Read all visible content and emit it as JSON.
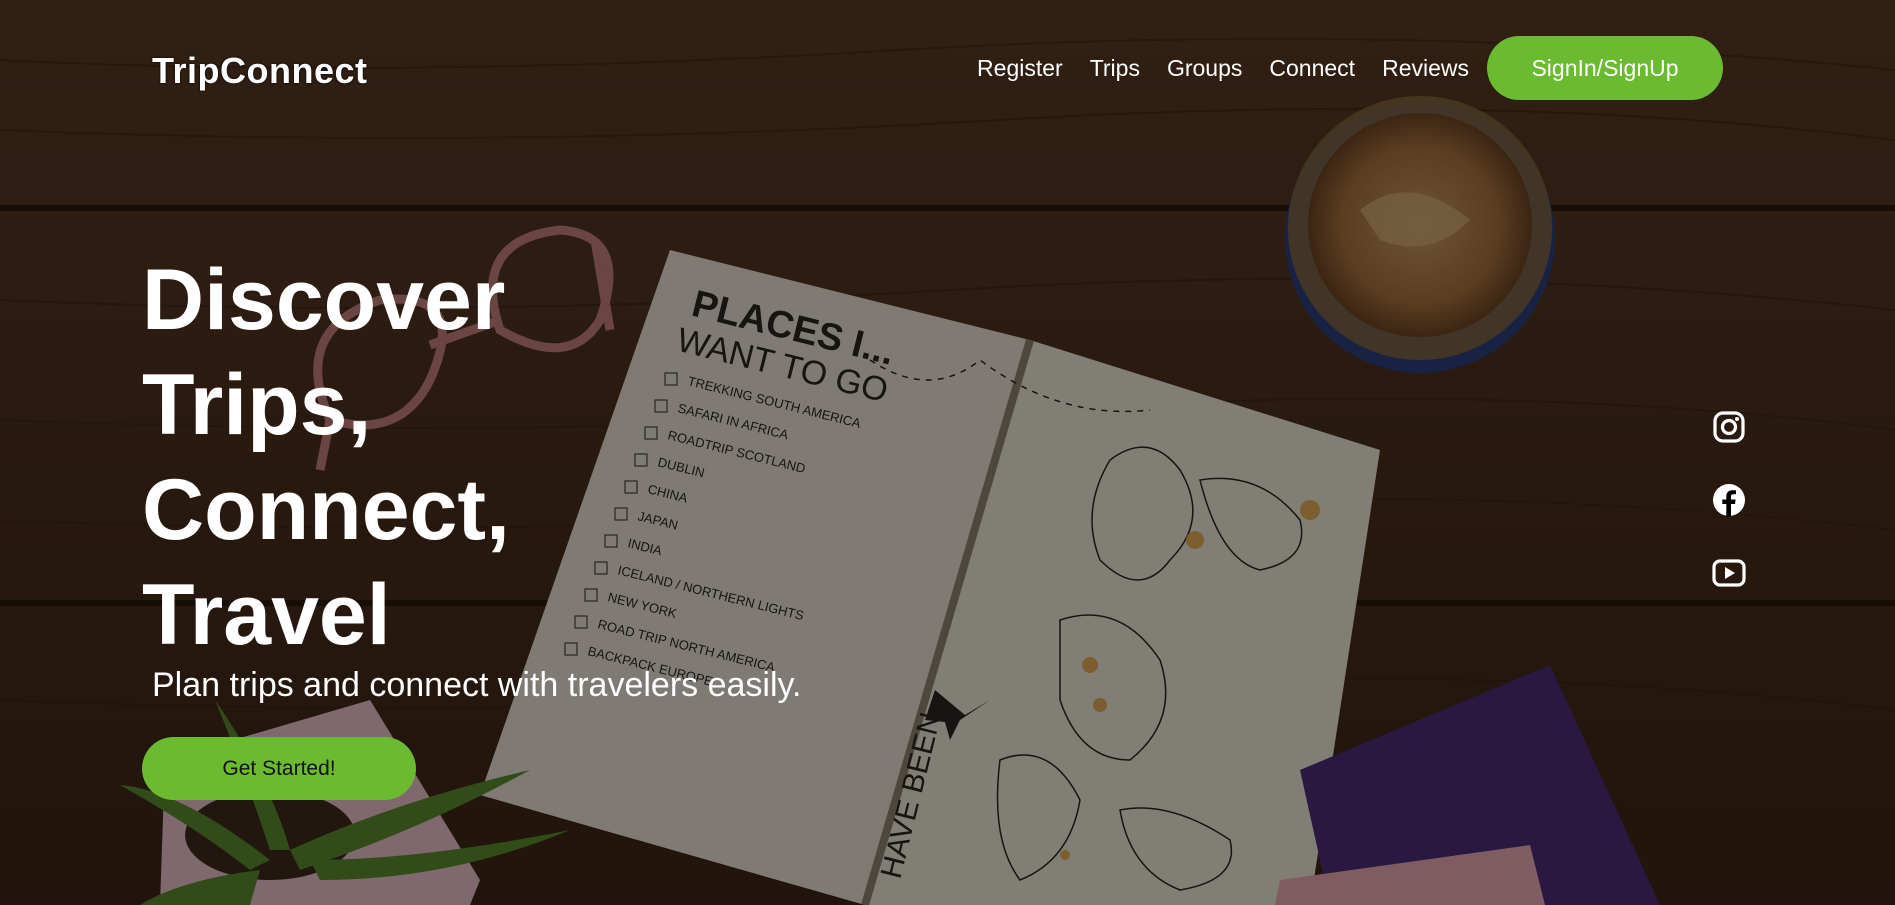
{
  "brand": {
    "name": "TripConnect"
  },
  "nav": {
    "items": [
      {
        "label": "Register"
      },
      {
        "label": "Trips"
      },
      {
        "label": "Groups"
      },
      {
        "label": "Connect"
      },
      {
        "label": "Reviews"
      }
    ],
    "signin_label": "SignIn/SignUp"
  },
  "hero": {
    "title_lines": [
      "Discover",
      "Trips,",
      "Connect,",
      "Travel"
    ],
    "subtitle": "Plan trips and connect with travelers easily.",
    "cta_label": "Get Started!"
  },
  "background": {
    "notebook_heading": "PLACES I...",
    "notebook_subheading": "WANT TO GO",
    "checklist": [
      "TREKKING SOUTH AMERICA",
      "SAFARI IN AFRICA",
      "ROADTRIP SCOTLAND",
      "DUBLIN",
      "CHINA",
      "JAPAN",
      "INDIA",
      "ICELAND / NORTHERN LIGHTS",
      "NEW YORK",
      "ROAD TRIP NORTH AMERICA",
      "BACKPACK EUROPE"
    ],
    "map_caption": "HAVE BEEN"
  },
  "social": {
    "icons": [
      "instagram-icon",
      "facebook-icon",
      "youtube-icon"
    ]
  },
  "colors": {
    "accent": "#6abb2f",
    "text": "#ffffff",
    "cta_text": "#111111"
  }
}
